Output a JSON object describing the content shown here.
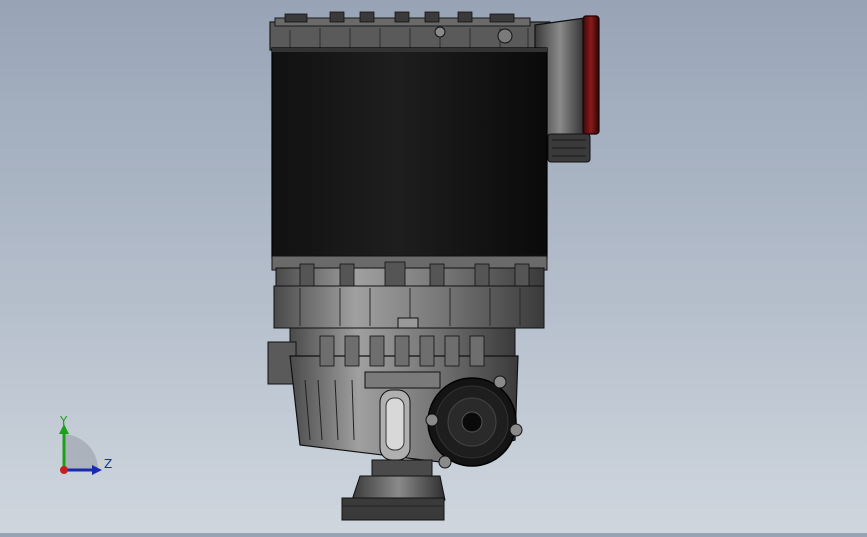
{
  "viewport": {
    "background_top": "#98a4b6",
    "background_bottom": "#cfd6de"
  },
  "model": {
    "body_color": "#0a0a0a",
    "housing_color": "#6e6e6e",
    "accent_color": "#8b1a1a"
  },
  "triad": {
    "y_label": "Y",
    "z_label": "Z",
    "y_color": "#1aa01a",
    "z_color": "#1a2ab0",
    "origin_color": "#c81e1e"
  }
}
